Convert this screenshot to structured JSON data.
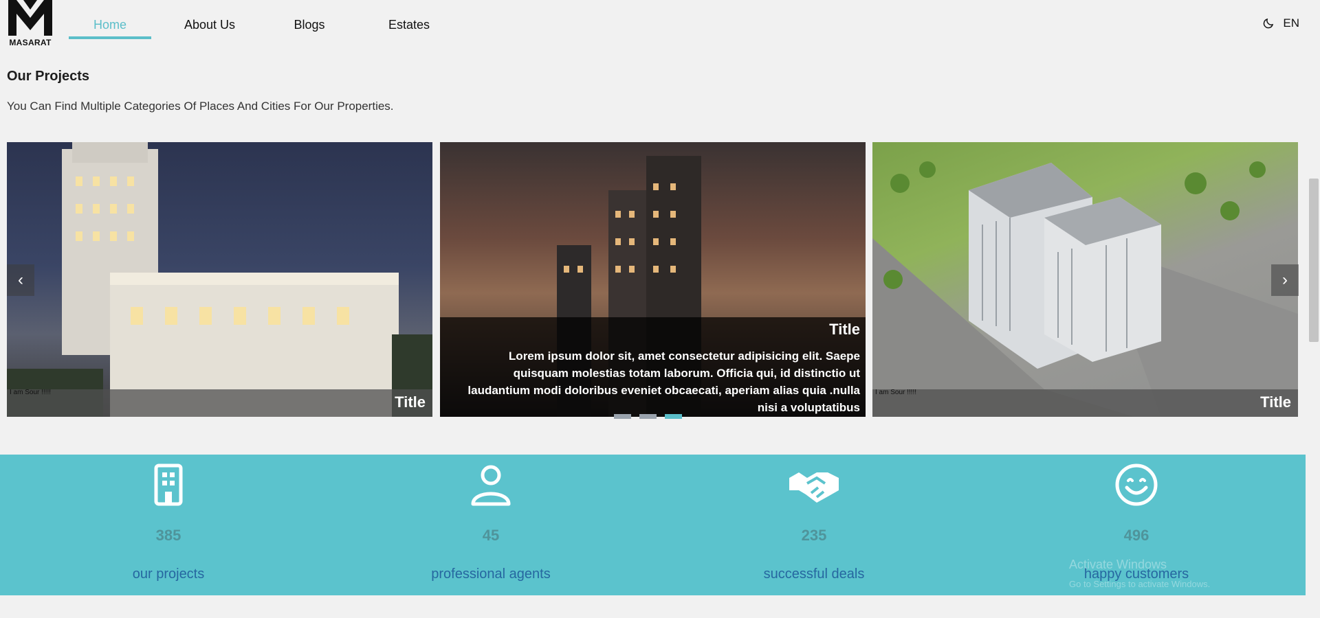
{
  "header": {
    "logo_text": "MASARAT",
    "nav": [
      "Home",
      "About Us",
      "Blogs",
      "Estates"
    ],
    "lang": "EN",
    "theme_icon": "moon-icon"
  },
  "section": {
    "title": "Our Projects",
    "subtitle": "You Can Find Multiple Categories Of Places And Cities For Our Properties."
  },
  "carousel": {
    "cards": [
      {
        "title": "Title",
        "tag": "I am Sour !!!!!"
      },
      {
        "title": "Title",
        "text": "Lorem ipsum dolor sit, amet consectetur adipisicing elit. Saepe quisquam molestias totam laborum. Officia qui, id distinctio ut laudantium modi doloribus eveniet obcaecati, aperiam alias quia .nulla nisi a voluptatibus"
      },
      {
        "title": "Title",
        "tag": "I am Sour !!!!!"
      }
    ],
    "prev_icon": "chevron-left-icon",
    "next_icon": "chevron-right-icon",
    "active_dot": 3
  },
  "stats": [
    {
      "icon": "building-icon",
      "value": "385",
      "label": "our projects"
    },
    {
      "icon": "user-icon",
      "value": "45",
      "label": "professional agents"
    },
    {
      "icon": "handshake-icon",
      "value": "235",
      "label": "successful deals"
    },
    {
      "icon": "smile-icon",
      "value": "496",
      "label": "happy customers"
    }
  ],
  "watermark": {
    "line1": "Activate Windows",
    "line2": "Go to Settings to activate Windows."
  },
  "colors": {
    "accent": "#5bbec9",
    "stats_bg": "#5bc3cd",
    "stat_label": "#2667a0",
    "stat_value": "#4f949b"
  }
}
